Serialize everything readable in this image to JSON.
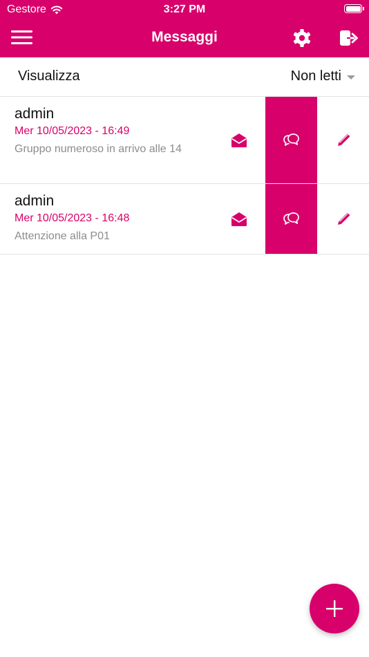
{
  "status_bar": {
    "carrier": "Gestore",
    "time": "3:27 PM"
  },
  "nav": {
    "title": "Messaggi",
    "menu_icon": "hamburger-menu-icon",
    "settings_icon": "gear-icon",
    "logout_icon": "logout-icon"
  },
  "filter": {
    "label": "Visualizza",
    "selected": "Non letti"
  },
  "messages": [
    {
      "sender": "admin",
      "date": "Mer 10/05/2023 - 16:49",
      "preview": "Gruppo numeroso in arrivo alle 14"
    },
    {
      "sender": "admin",
      "date": "Mer 10/05/2023 - 16:48",
      "preview": "Attenzione alla P01"
    }
  ],
  "actions": {
    "mark_read_icon": "envelope-open-icon",
    "reply_icon": "chat-bubbles-icon",
    "edit_icon": "pencil-icon"
  },
  "fab": {
    "icon": "plus-icon"
  },
  "colors": {
    "accent": "#d8006b",
    "muted_text": "#8c8c8c",
    "divider": "#e3e3e3"
  }
}
